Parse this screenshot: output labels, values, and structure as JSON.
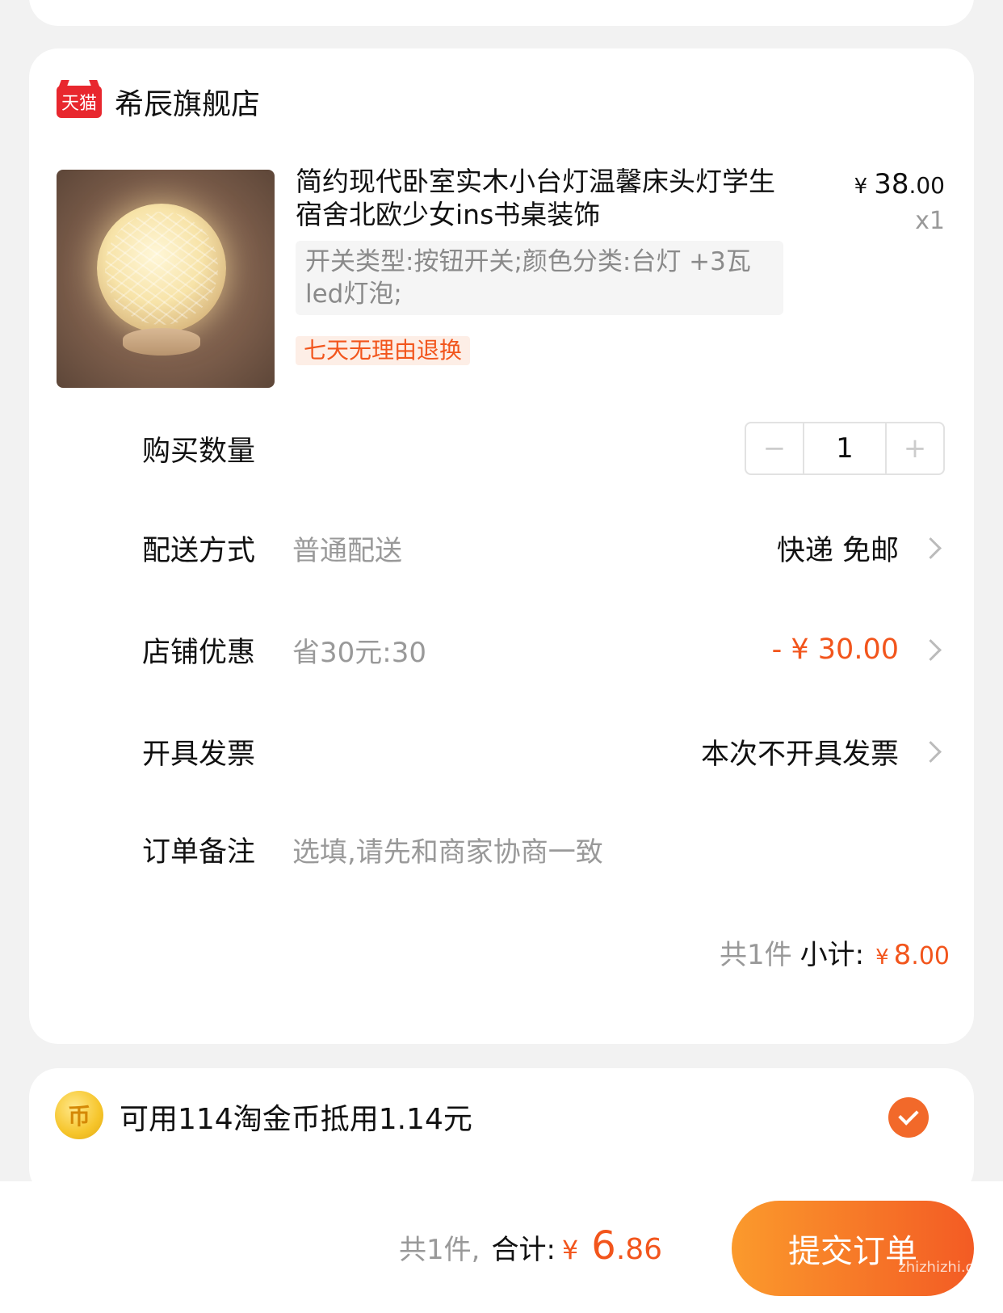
{
  "store": {
    "badge": "天猫",
    "name": "希辰旗舰店"
  },
  "product": {
    "title": "简约现代卧室实木小台灯温馨床头灯学生宿舍北欧少女ins书桌装饰",
    "price_symbol": "¥",
    "price_int": "38",
    "price_dec": ".00",
    "qty": "x1",
    "spec": "开关类型:按钮开关;颜色分类:台灯 +3瓦led灯泡;",
    "return_tag": "七天无理由退换"
  },
  "quantity": {
    "label": "购买数量",
    "minus": "−",
    "value": "1",
    "plus": "+"
  },
  "delivery": {
    "label": "配送方式",
    "sub": "普通配送",
    "value": "快递 免邮"
  },
  "discount": {
    "label": "店铺优惠",
    "sub": "省30元:30",
    "value": "- ¥ 30.00"
  },
  "invoice": {
    "label": "开具发票",
    "value": "本次不开具发票"
  },
  "note": {
    "label": "订单备注",
    "placeholder": "选填,请先和商家协商一致"
  },
  "subtotal": {
    "count": "共1件",
    "label": "小计:",
    "symbol": "¥",
    "amount_int": "8",
    "amount_dec": ".00"
  },
  "coin": {
    "icon_glyph": "币",
    "text": "可用114淘金币抵用1.14元"
  },
  "footer": {
    "count": "共1件,",
    "label": "合计:",
    "symbol": "¥",
    "amount_int": "6",
    "amount_dec": ".86",
    "submit": "提交订单",
    "watermark": "zhizhizhi.com"
  },
  "colors": {
    "accent": "#f2551c",
    "tmall": "#e8272e",
    "button_start": "#fb9a2c",
    "button_end": "#f35b24"
  }
}
